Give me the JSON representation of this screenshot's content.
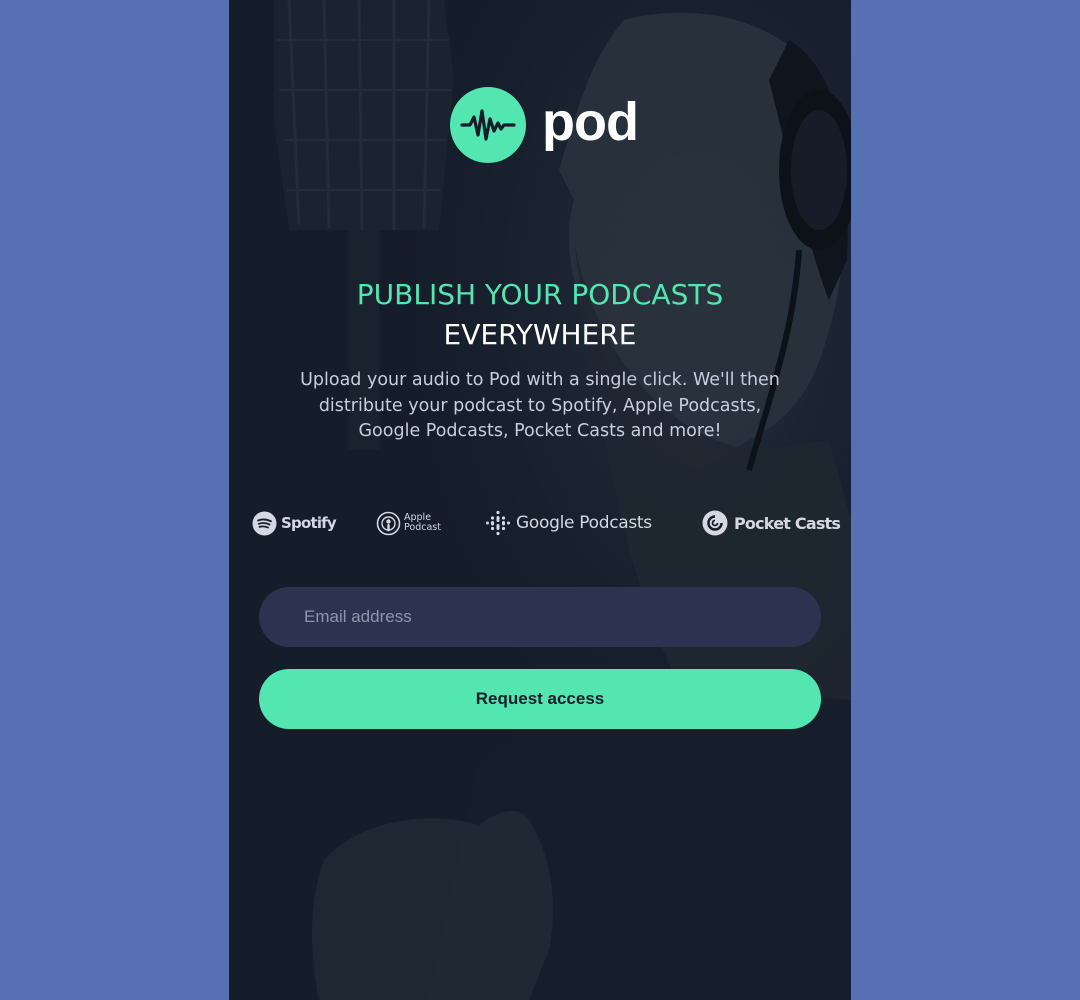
{
  "brand": {
    "name": "pod",
    "logo_icon": "waveform-icon",
    "accent_color": "#54e6b0",
    "background_color": "#151c2a",
    "page_background": "#5670b3"
  },
  "hero": {
    "headline_accent": "PUBLISH YOUR PODCASTS",
    "headline_main": "EVERYWHERE",
    "description": "Upload your audio to Pod with a single click. We'll then distribute your podcast to Spotify, Apple Podcasts, Google Podcasts, Pocket Casts and more!"
  },
  "platforms": [
    {
      "name": "Spotify",
      "icon": "spotify-icon"
    },
    {
      "name_line1": "Apple",
      "name_line2": "Podcast",
      "icon": "apple-podcasts-icon"
    },
    {
      "name": "Google Podcasts",
      "icon": "google-podcasts-icon"
    },
    {
      "name": "Pocket Casts",
      "icon": "pocket-casts-icon"
    }
  ],
  "form": {
    "email_placeholder": "Email address",
    "email_value": "",
    "submit_label": "Request access"
  }
}
